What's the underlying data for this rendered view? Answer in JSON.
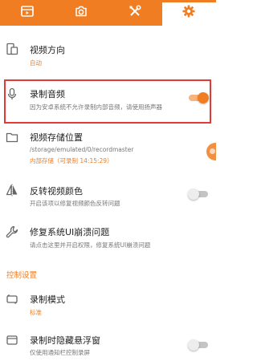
{
  "topbar": {
    "tabs": [
      {
        "icon": "video-list-icon"
      },
      {
        "icon": "camera-icon"
      },
      {
        "icon": "tools-icon"
      },
      {
        "icon": "gear-icon",
        "active": true
      }
    ]
  },
  "settings": {
    "video_orientation": {
      "title": "视频方向",
      "value": "自动"
    },
    "record_audio": {
      "title": "录制音频",
      "desc": "因为安卓系统不允许录制内部音频，请使用扬声器",
      "enabled": true
    },
    "storage": {
      "title": "视频存储位置",
      "path": "/storage/emulated/0/recordmaster",
      "status": "内部存储（可录制 14:15:29）"
    },
    "invert_color": {
      "title": "反转视频颜色",
      "desc": "开启该项以修复视频颜色反转问题",
      "enabled": false
    },
    "fix_crash": {
      "title": "修复系统UI崩溃问题",
      "desc": "请点击这里并开启权限，修复系统UI崩溃问题"
    }
  },
  "control_section": {
    "header": "控制设置",
    "record_mode": {
      "title": "录制模式",
      "value": "标准"
    },
    "hide_float": {
      "title": "录制时隐藏悬浮窗",
      "desc": "仅使用通知栏控制录屏",
      "enabled": false
    }
  },
  "colors": {
    "accent": "#f07d22",
    "highlight": "#e53935"
  }
}
